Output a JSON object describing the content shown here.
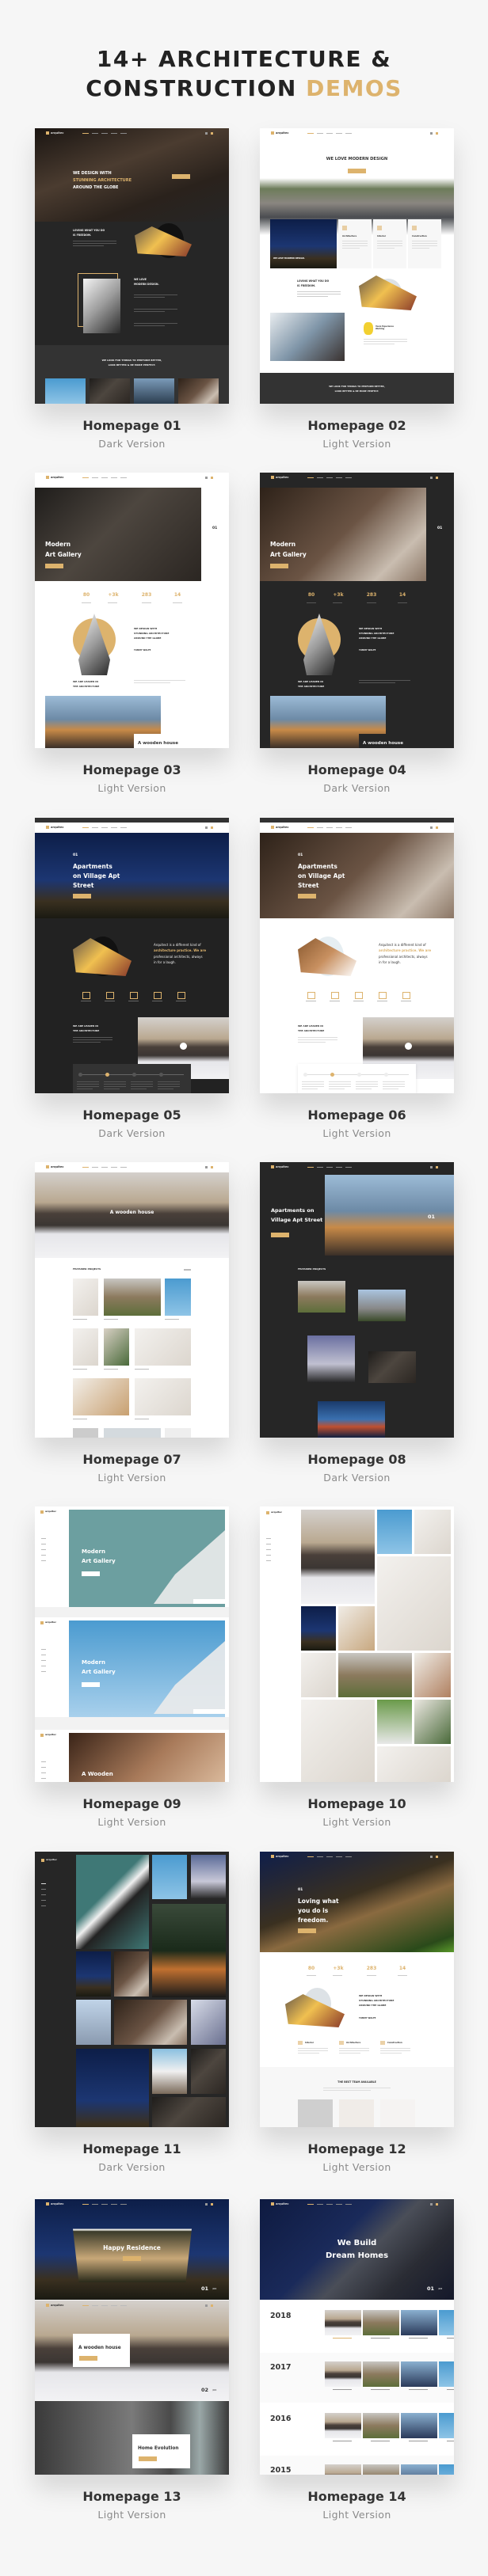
{
  "header": {
    "title_line1": "14+ ARCHITECTURE &",
    "title_line2_main": "CONSTRUCTION ",
    "title_line2_accent": "DEMOS"
  },
  "colors": {
    "background": "#f6f6f6",
    "accent": "#ddb36d",
    "heading": "#222222",
    "dark_theme": "#262626"
  },
  "logo_text": "arquitec",
  "demos": [
    {
      "title": "Homepage 01",
      "subtitle": "Dark Version",
      "theme": "dark",
      "preview": {
        "h1": "WE DESIGN WITH",
        "h2": "STUNNING ARCHITECTURE",
        "h3": "AROUND THE GLOBE",
        "s1": "LOVING WHAT YOU DO",
        "s2": "IS FREEDOM.",
        "m1": "WE LOVE",
        "m2": "MODERN DESIGN.",
        "f1": "WE LOOK FOR THINGS TO PERFORM BETTER,",
        "f2": "LOOK BETTER & BE MORE PERFECT."
      }
    },
    {
      "title": "Homepage 02",
      "subtitle": "Light Version",
      "theme": "light",
      "preview": {
        "h1": "WE LOVE MODERN DESIGN",
        "c1": "WE LOVE MODERN DESIGN.",
        "k1": "Architecture",
        "k2": "Interior",
        "k3": "Construction",
        "s1": "LOVING WHAT YOU DO",
        "s2": "IS FREEDOM.",
        "y1": "Years Experience Working",
        "f1": "WE LOOK FOR THINGS TO PERFORM BETTER,",
        "f2": "LOOK BETTER & BE MORE PERFECT."
      }
    },
    {
      "title": "Homepage 03",
      "subtitle": "Light Version",
      "theme": "light",
      "preview": {
        "h1": "Modern",
        "h2": "Art Gallery",
        "slide": "01",
        "n1": "80",
        "n2": "+3k",
        "n3": "283",
        "n4": "14",
        "d1": "WE DESIGN WITH",
        "d2": "STUNNING ARCHITECTURE",
        "d3": "AROUND THE GLOBE",
        "author": "TOMMY WOLFE",
        "l1": "WE ARE LEADER IN",
        "l2": "THE ARCHITECTURE",
        "w": "A wooden house"
      }
    },
    {
      "title": "Homepage 04",
      "subtitle": "Dark Version",
      "theme": "dark",
      "preview": {
        "h1": "Modern",
        "h2": "Art Gallery",
        "slide": "01",
        "n1": "80",
        "n2": "+3k",
        "n3": "283",
        "n4": "14",
        "d1": "WE DESIGN WITH",
        "d2": "STUNNING ARCHITECTURE",
        "d3": "AROUND THE GLOBE",
        "author": "TOMMY WOLFE",
        "l1": "WE ARE LEADER IN",
        "l2": "THE ARCHITECTURE",
        "w": "A wooden house"
      }
    },
    {
      "title": "Homepage 05",
      "subtitle": "Dark Version",
      "theme": "dark",
      "preview": {
        "num": "01",
        "h1": "Apartments",
        "h2": "on Village Apt",
        "h3": "Street",
        "p1": "Arquitect is a different kind of",
        "p2": "architecture practice. We are",
        "p3": "professional architects, always",
        "p4": "in for a laugh.",
        "l1": "WE ARE LEADER IN",
        "l2": "THE ARCHITECTURE"
      }
    },
    {
      "title": "Homepage 06",
      "subtitle": "Light Version",
      "theme": "light",
      "preview": {
        "num": "01",
        "h1": "Apartments",
        "h2": "on Village Apt",
        "h3": "Street",
        "p1": "Arquitect is a different kind of",
        "p2": "architecture practice. We are",
        "p3": "professional architects, always",
        "p4": "in for a laugh.",
        "l1": "WE ARE LEADER IN",
        "l2": "THE ARCHITECTURE"
      }
    },
    {
      "title": "Homepage 07",
      "subtitle": "Light Version",
      "theme": "light",
      "preview": {
        "h1": "A wooden house",
        "fp": "FEATURED PROJECTS"
      }
    },
    {
      "title": "Homepage 08",
      "subtitle": "Dark Version",
      "theme": "dark",
      "preview": {
        "h1": "Apartments on",
        "h2": "Village Apt Street",
        "slide": "01",
        "fp": "FEATURED PROJECTS"
      }
    },
    {
      "title": "Homepage 09",
      "subtitle": "Light Version",
      "theme": "light",
      "preview": {
        "a1": "Modern",
        "a2": "Art Gallery",
        "b1": "Modern",
        "b2": "Art Gallery",
        "c1": "A Wooden"
      }
    },
    {
      "title": "Homepage 10",
      "subtitle": "Light Version",
      "theme": "light",
      "preview": {}
    },
    {
      "title": "Homepage 11",
      "subtitle": "Dark Version",
      "theme": "dark",
      "preview": {}
    },
    {
      "title": "Homepage 12",
      "subtitle": "Light Version",
      "theme": "light",
      "preview": {
        "num": "01",
        "h1": "Loving what",
        "h2": "you do is",
        "h3": "freedom.",
        "n1": "80",
        "n2": "+3k",
        "n3": "283",
        "n4": "14",
        "d1": "WE DESIGN WITH",
        "d2": "STUNNING ARCHITECTURE",
        "d3": "AROUND THE GLOBE",
        "author": "TOMMY WOLFE",
        "k1": "Interior",
        "k2": "Architecture",
        "k3": "Construction",
        "team": "THE BEST TEAM AVAILABLE"
      }
    },
    {
      "title": "Homepage 13",
      "subtitle": "Light Version",
      "theme": "light",
      "preview": {
        "h1": "Happy Residence",
        "s1": "01",
        "s1t": "/04",
        "h2": "A wooden house",
        "s2": "02",
        "s2t": "/04",
        "h3": "Home Evolution"
      }
    },
    {
      "title": "Homepage 14",
      "subtitle": "Light Version",
      "theme": "light",
      "preview": {
        "h1": "We Build",
        "h2": "Dream Homes",
        "slide": "01",
        "slide_total": "/03",
        "y1": "2018",
        "y2": "2017",
        "y3": "2016",
        "y4": "2015"
      }
    }
  ]
}
